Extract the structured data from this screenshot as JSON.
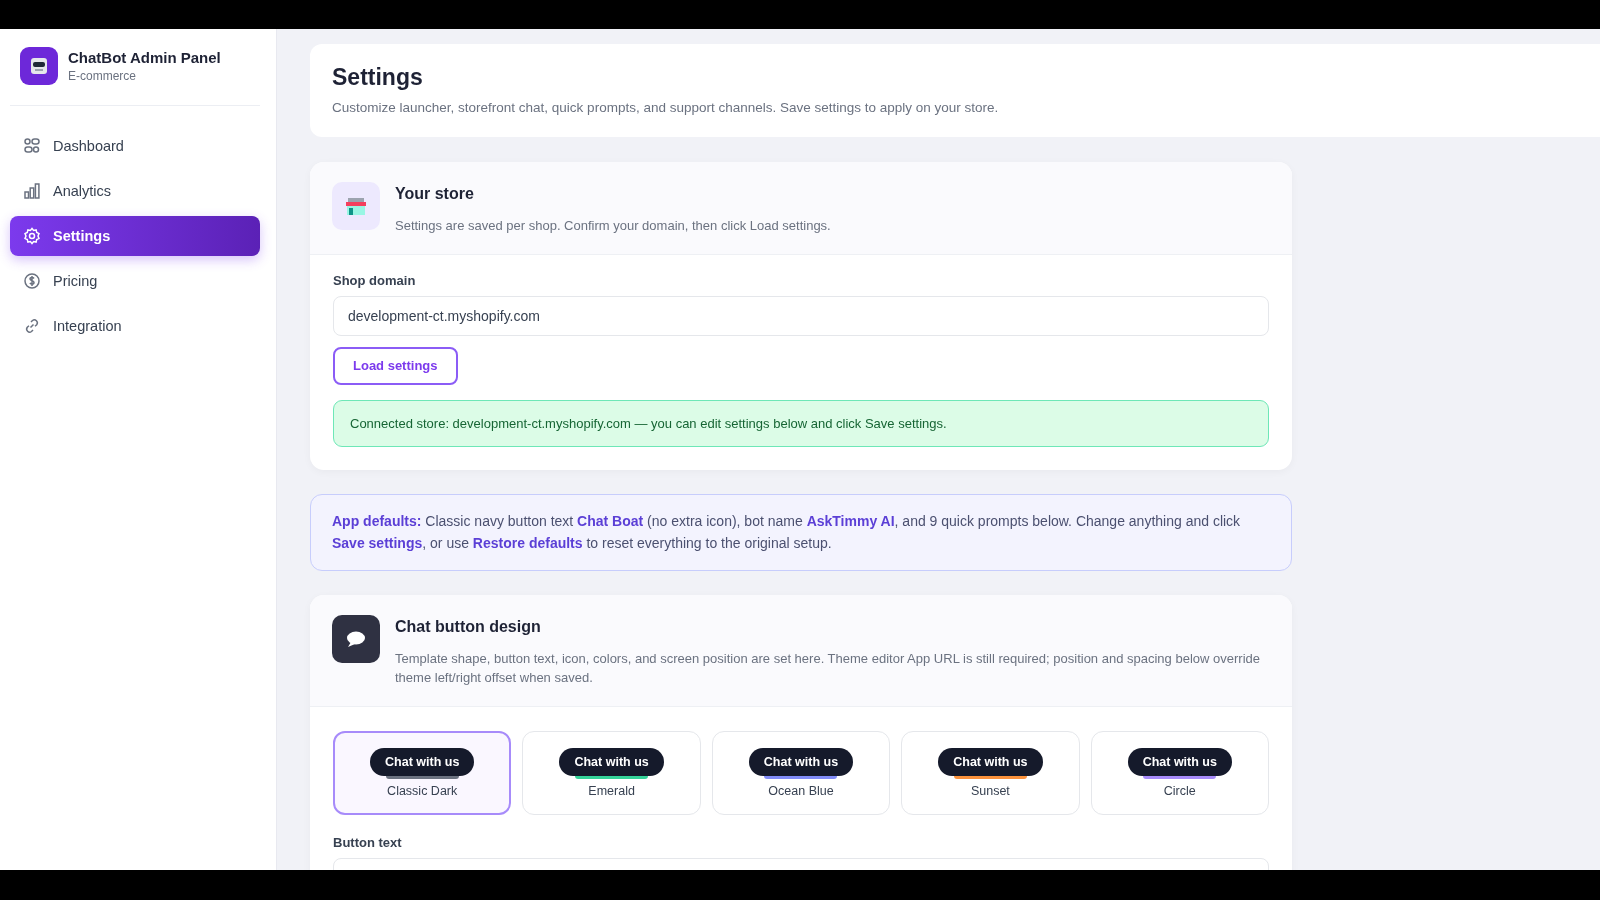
{
  "brand": {
    "title": "ChatBot Admin Panel",
    "subtitle": "E-commerce"
  },
  "nav": [
    {
      "label": "Dashboard",
      "selected": false
    },
    {
      "label": "Analytics",
      "selected": false
    },
    {
      "label": "Settings",
      "selected": true
    },
    {
      "label": "Pricing",
      "selected": false
    },
    {
      "label": "Integration",
      "selected": false
    }
  ],
  "header": {
    "title": "Settings",
    "subtitle": "Customize launcher, storefront chat, quick prompts, and support channels. Save settings to apply on your store."
  },
  "store": {
    "title": "Your store",
    "description": "Settings are saved per shop. Confirm your domain, then click Load settings.",
    "field_label": "Shop domain",
    "domain": "development-ct.myshopify.com",
    "load_button": "Load settings",
    "notice": "Connected store: development-ct.myshopify.com — you can edit settings below and click Save settings."
  },
  "defaults_note": "**App defaults:** Classic navy button text **Chat Boat** (no extra icon), bot name **AskTimmy AI**, and 9 quick prompts below. Change anything and click **Save settings**, or use **Restore defaults** to reset everything to the original setup.",
  "design": {
    "title": "Chat button design",
    "description": "Template shape, button text, icon, colors, and screen position are set here. Theme editor App URL is still required; position and spacing below override theme left/right offset when saved.",
    "templates": [
      {
        "button": "Chat with us",
        "name": "Classic Dark",
        "color": "#6b7280",
        "selected": true
      },
      {
        "button": "Chat with us",
        "name": "Emerald",
        "color": "#34d399",
        "selected": false
      },
      {
        "button": "Chat with us",
        "name": "Ocean Blue",
        "color": "#818cf8",
        "selected": false
      },
      {
        "button": "Chat with us",
        "name": "Sunset",
        "color": "#fb923c",
        "selected": false
      },
      {
        "button": "Chat with us",
        "name": "Circle",
        "color": "#a78bfa",
        "selected": false
      }
    ],
    "button_text_label": "Button text"
  }
}
